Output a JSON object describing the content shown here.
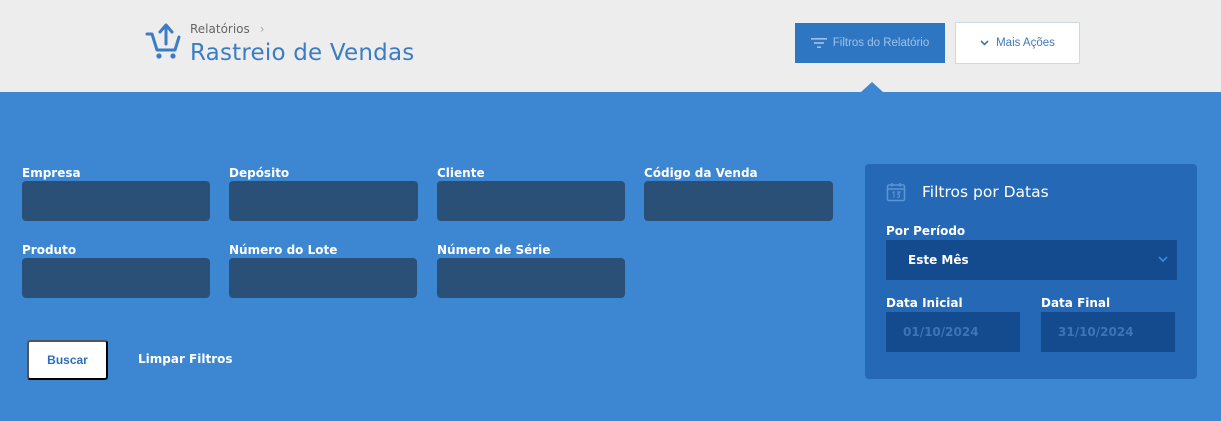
{
  "header": {
    "breadcrumb": "Relatórios",
    "title": "Rastreio de Vendas",
    "btn_filtros": "Filtros do Relatório",
    "btn_mais": "Mais Ações"
  },
  "filters": {
    "empresa": {
      "label": "Empresa",
      "value": ""
    },
    "deposito": {
      "label": "Depósito",
      "value": ""
    },
    "cliente": {
      "label": "Cliente",
      "value": ""
    },
    "codigo_venda": {
      "label": "Código da Venda",
      "value": ""
    },
    "produto": {
      "label": "Produto",
      "value": ""
    },
    "numero_lote": {
      "label": "Número do Lote",
      "value": ""
    },
    "numero_serie": {
      "label": "Número de Série",
      "value": ""
    }
  },
  "actions": {
    "buscar": "Buscar",
    "limpar": "Limpar Filtros"
  },
  "date_filters": {
    "title": "Filtros por Datas",
    "periodo_label": "Por Período",
    "periodo_value": "Este Mês",
    "data_inicial_label": "Data Inicial",
    "data_inicial_value": "01/10/2024",
    "data_final_label": "Data Final",
    "data_final_value": "31/10/2024"
  },
  "colors": {
    "accent": "#3d86d1",
    "header_bg": "#ededed",
    "field_bg": "#2a5078",
    "panel_bg": "#2568b5"
  },
  "icons": [
    "cart-upload-icon",
    "chevron-right-icon",
    "filter-lines-icon",
    "chevron-down-icon",
    "calendar-icon"
  ]
}
